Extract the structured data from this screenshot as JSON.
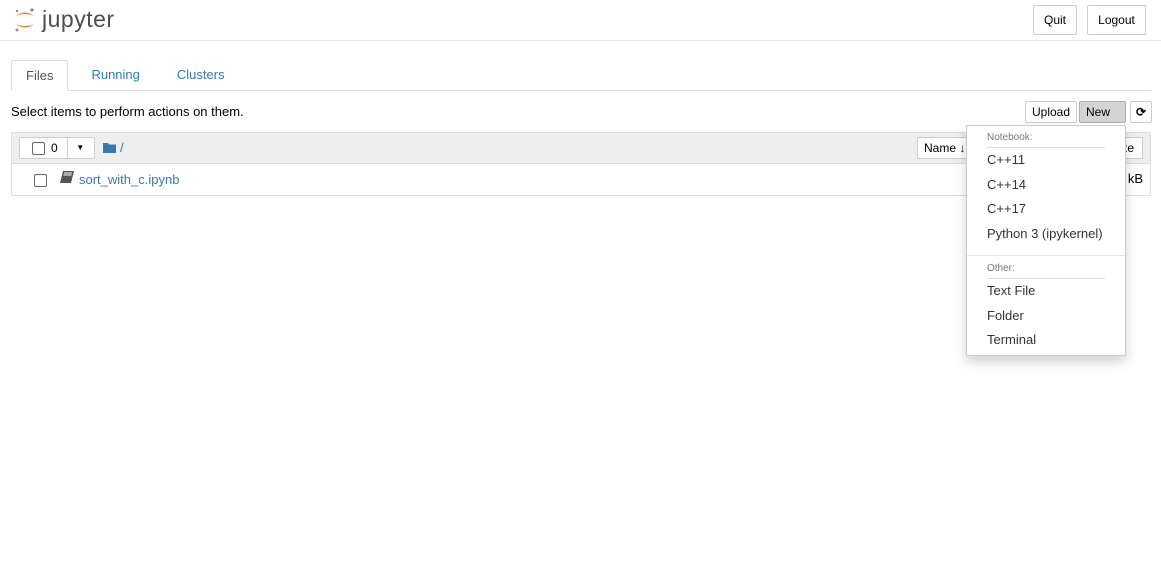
{
  "header": {
    "logo_text": "jupyter",
    "quit": "Quit",
    "logout": "Logout"
  },
  "tabs": [
    {
      "label": "Files"
    },
    {
      "label": "Running"
    },
    {
      "label": "Clusters"
    }
  ],
  "instructions": "Select items to perform actions on them.",
  "toolbar": {
    "upload": "Upload",
    "new": "New",
    "refresh_icon": "refresh-icon"
  },
  "list": {
    "selected_count": "0",
    "path": "/",
    "sort_label": "Name",
    "size_label": "File size",
    "items": [
      {
        "name": "sort_with_c.ipynb",
        "size": "kB",
        "icon": "notebook-icon"
      }
    ]
  },
  "new_menu": {
    "notebook_header": "Notebook:",
    "notebook_items": [
      "C++11",
      "C++14",
      "C++17",
      "Python 3 (ipykernel)"
    ],
    "other_header": "Other:",
    "other_items": [
      "Text File",
      "Folder",
      "Terminal"
    ]
  },
  "colors": {
    "link": "#337ab7",
    "logo_orange": "#f37726"
  }
}
